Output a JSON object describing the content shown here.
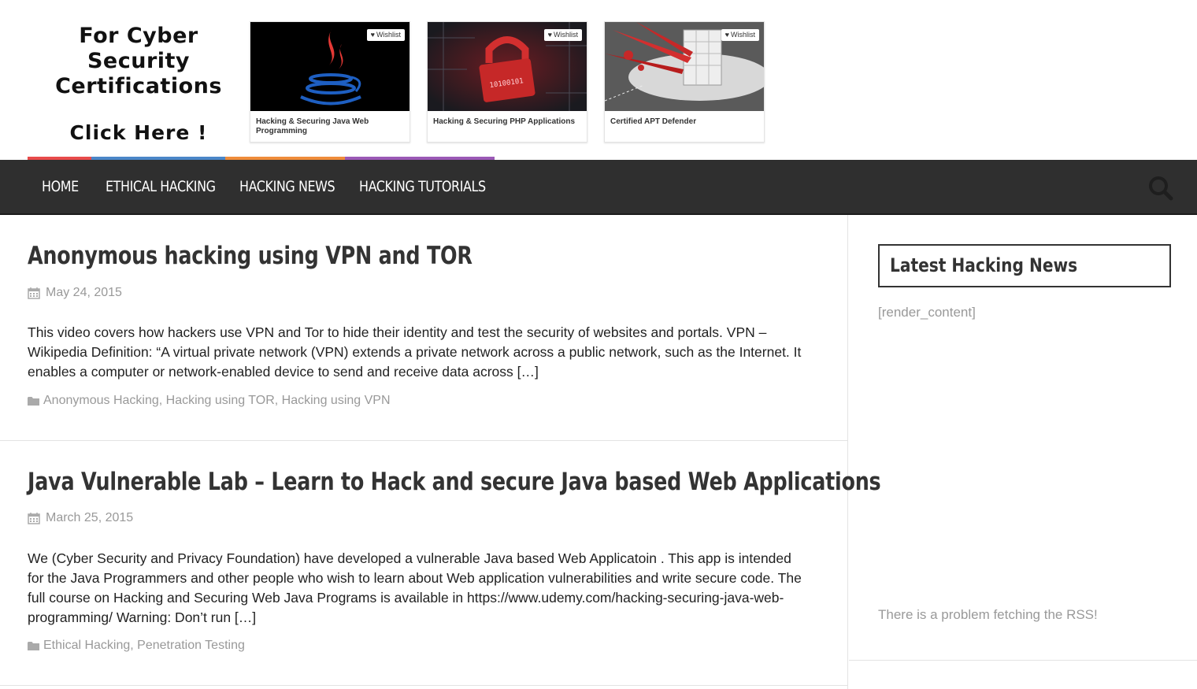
{
  "promo": {
    "line1": "For Cyber Security",
    "line2": "Certifications",
    "cta": "Click Here !"
  },
  "courses": [
    {
      "title": "Hacking & Securing Java Web Programming",
      "wishlist": "Wishlist",
      "image": "java-logo-image"
    },
    {
      "title": "Hacking & Securing PHP Applications",
      "wishlist": "Wishlist",
      "image": "red-padlock-circuit-image"
    },
    {
      "title": "Certified APT Defender",
      "wishlist": "Wishlist",
      "image": "building-under-attack-image"
    }
  ],
  "nav": {
    "items": [
      "HOME",
      "ETHICAL HACKING",
      "HACKING NEWS",
      "HACKING TUTORIALS"
    ],
    "strip_colors": [
      "#e84b4b",
      "#4a86c8",
      "#ef8c3a",
      "#9b59b6"
    ]
  },
  "posts": [
    {
      "title": "Anonymous hacking using VPN and TOR",
      "date": "May 24, 2015",
      "excerpt": "This video covers how hackers use VPN and Tor to hide their identity and test the security of websites and portals. VPN – Wikipedia Definition: “A virtual private network (VPN) extends a private network across a public network, such as the Internet. It enables a computer or network-enabled device to send and receive data across […]",
      "categories": [
        "Anonymous Hacking",
        "Hacking using TOR",
        "Hacking using VPN"
      ]
    },
    {
      "title": "Java Vulnerable Lab – Learn to Hack and secure Java based Web Applications",
      "date": "March 25, 2015",
      "excerpt": "We (Cyber Security and Privacy Foundation) have developed a vulnerable Java based Web Applicatoin . This app is intended for the Java Programmers and other people who wish to learn about Web application vulnerabilities and write secure code. The full course on Hacking and Securing Web Java Programs is available in https://www.udemy.com/hacking-securing-java-web-programming/ Warning: Don’t run […]",
      "categories": [
        "Ethical Hacking",
        "Penetration Testing"
      ]
    }
  ],
  "sidebar": {
    "widget_title": "Latest Hacking News",
    "render_content": "[render_content]",
    "rss_error": "There is a problem fetching the RSS!"
  },
  "colors": {
    "nav_bg": "#2f2f2f",
    "meta_text": "#999999",
    "heading_text": "#333333"
  }
}
